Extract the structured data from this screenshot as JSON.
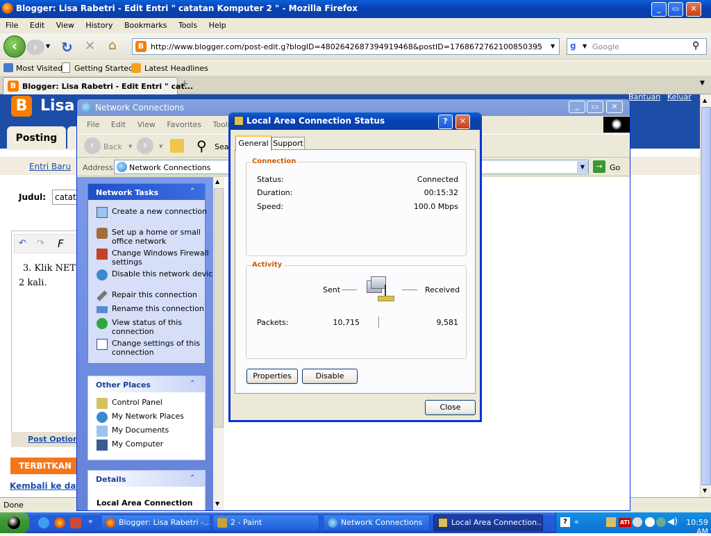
{
  "firefox": {
    "title": "Blogger: Lisa Rabetri - Edit Entri \" catatan Komputer 2 \" - Mozilla Firefox",
    "menu": [
      "File",
      "Edit",
      "View",
      "History",
      "Bookmarks",
      "Tools",
      "Help"
    ],
    "url": "http://www.blogger.com/post-edit.g?blogID=4802642687394919468&postID=1768672762100850395",
    "search_placeholder": "Google",
    "bookmarks": [
      "Most Visited",
      "Getting Started",
      "Latest Headlines"
    ],
    "tab_label": "Blogger: Lisa Rabetri - Edit Entri \" cat...",
    "status": "Done"
  },
  "blogger": {
    "brand": "Lisa",
    "top_links": [
      "Bantuan",
      "Keluar"
    ],
    "posting_tab": "Posting",
    "entri_baru": "Entri Baru",
    "judul_label": "Judul:",
    "judul_value": "catat",
    "editor_text_1": "3. Klik NET",
    "editor_text_2": "2 kali.",
    "post_options": "Post Options",
    "publish": "TERBITKAN",
    "back_link": "Kembali ke daft"
  },
  "netconn": {
    "title": "Network Connections",
    "menu": [
      "File",
      "Edit",
      "View",
      "Favorites",
      "Tools"
    ],
    "back": "Back",
    "search": "Sear",
    "address_label": "Address",
    "address_value": "Network Connections",
    "go": "Go",
    "tasks_header": "Network Tasks",
    "tasks": [
      "Create a new connection",
      "Set up a home or small office network",
      "Change Windows Firewall settings",
      "Disable this network device",
      "Repair this connection",
      "Rename this connection",
      "View status of this connection",
      "Change settings of this connection"
    ],
    "other_header": "Other Places",
    "other": [
      "Control Panel",
      "My Network Places",
      "My Documents",
      "My Computer"
    ],
    "details_header": "Details",
    "details_title": "Local Area Connection"
  },
  "dialog": {
    "title": "Local Area Connection Status",
    "tabs": [
      "General",
      "Support"
    ],
    "connection_group": "Connection",
    "status_label": "Status:",
    "status_value": "Connected",
    "duration_label": "Duration:",
    "duration_value": "00:15:32",
    "speed_label": "Speed:",
    "speed_value": "100.0 Mbps",
    "activity_group": "Activity",
    "sent": "Sent",
    "received": "Received",
    "packets_label": "Packets:",
    "packets_sent": "10,715",
    "packets_received": "9,581",
    "properties": "Properties",
    "disable": "Disable",
    "close": "Close"
  },
  "taskbar": {
    "start": "",
    "buttons": [
      "Blogger: Lisa Rabetri -...",
      "2 - Paint",
      "Network Connections",
      "Local Area Connection..."
    ],
    "clock": "10:59 AM"
  }
}
